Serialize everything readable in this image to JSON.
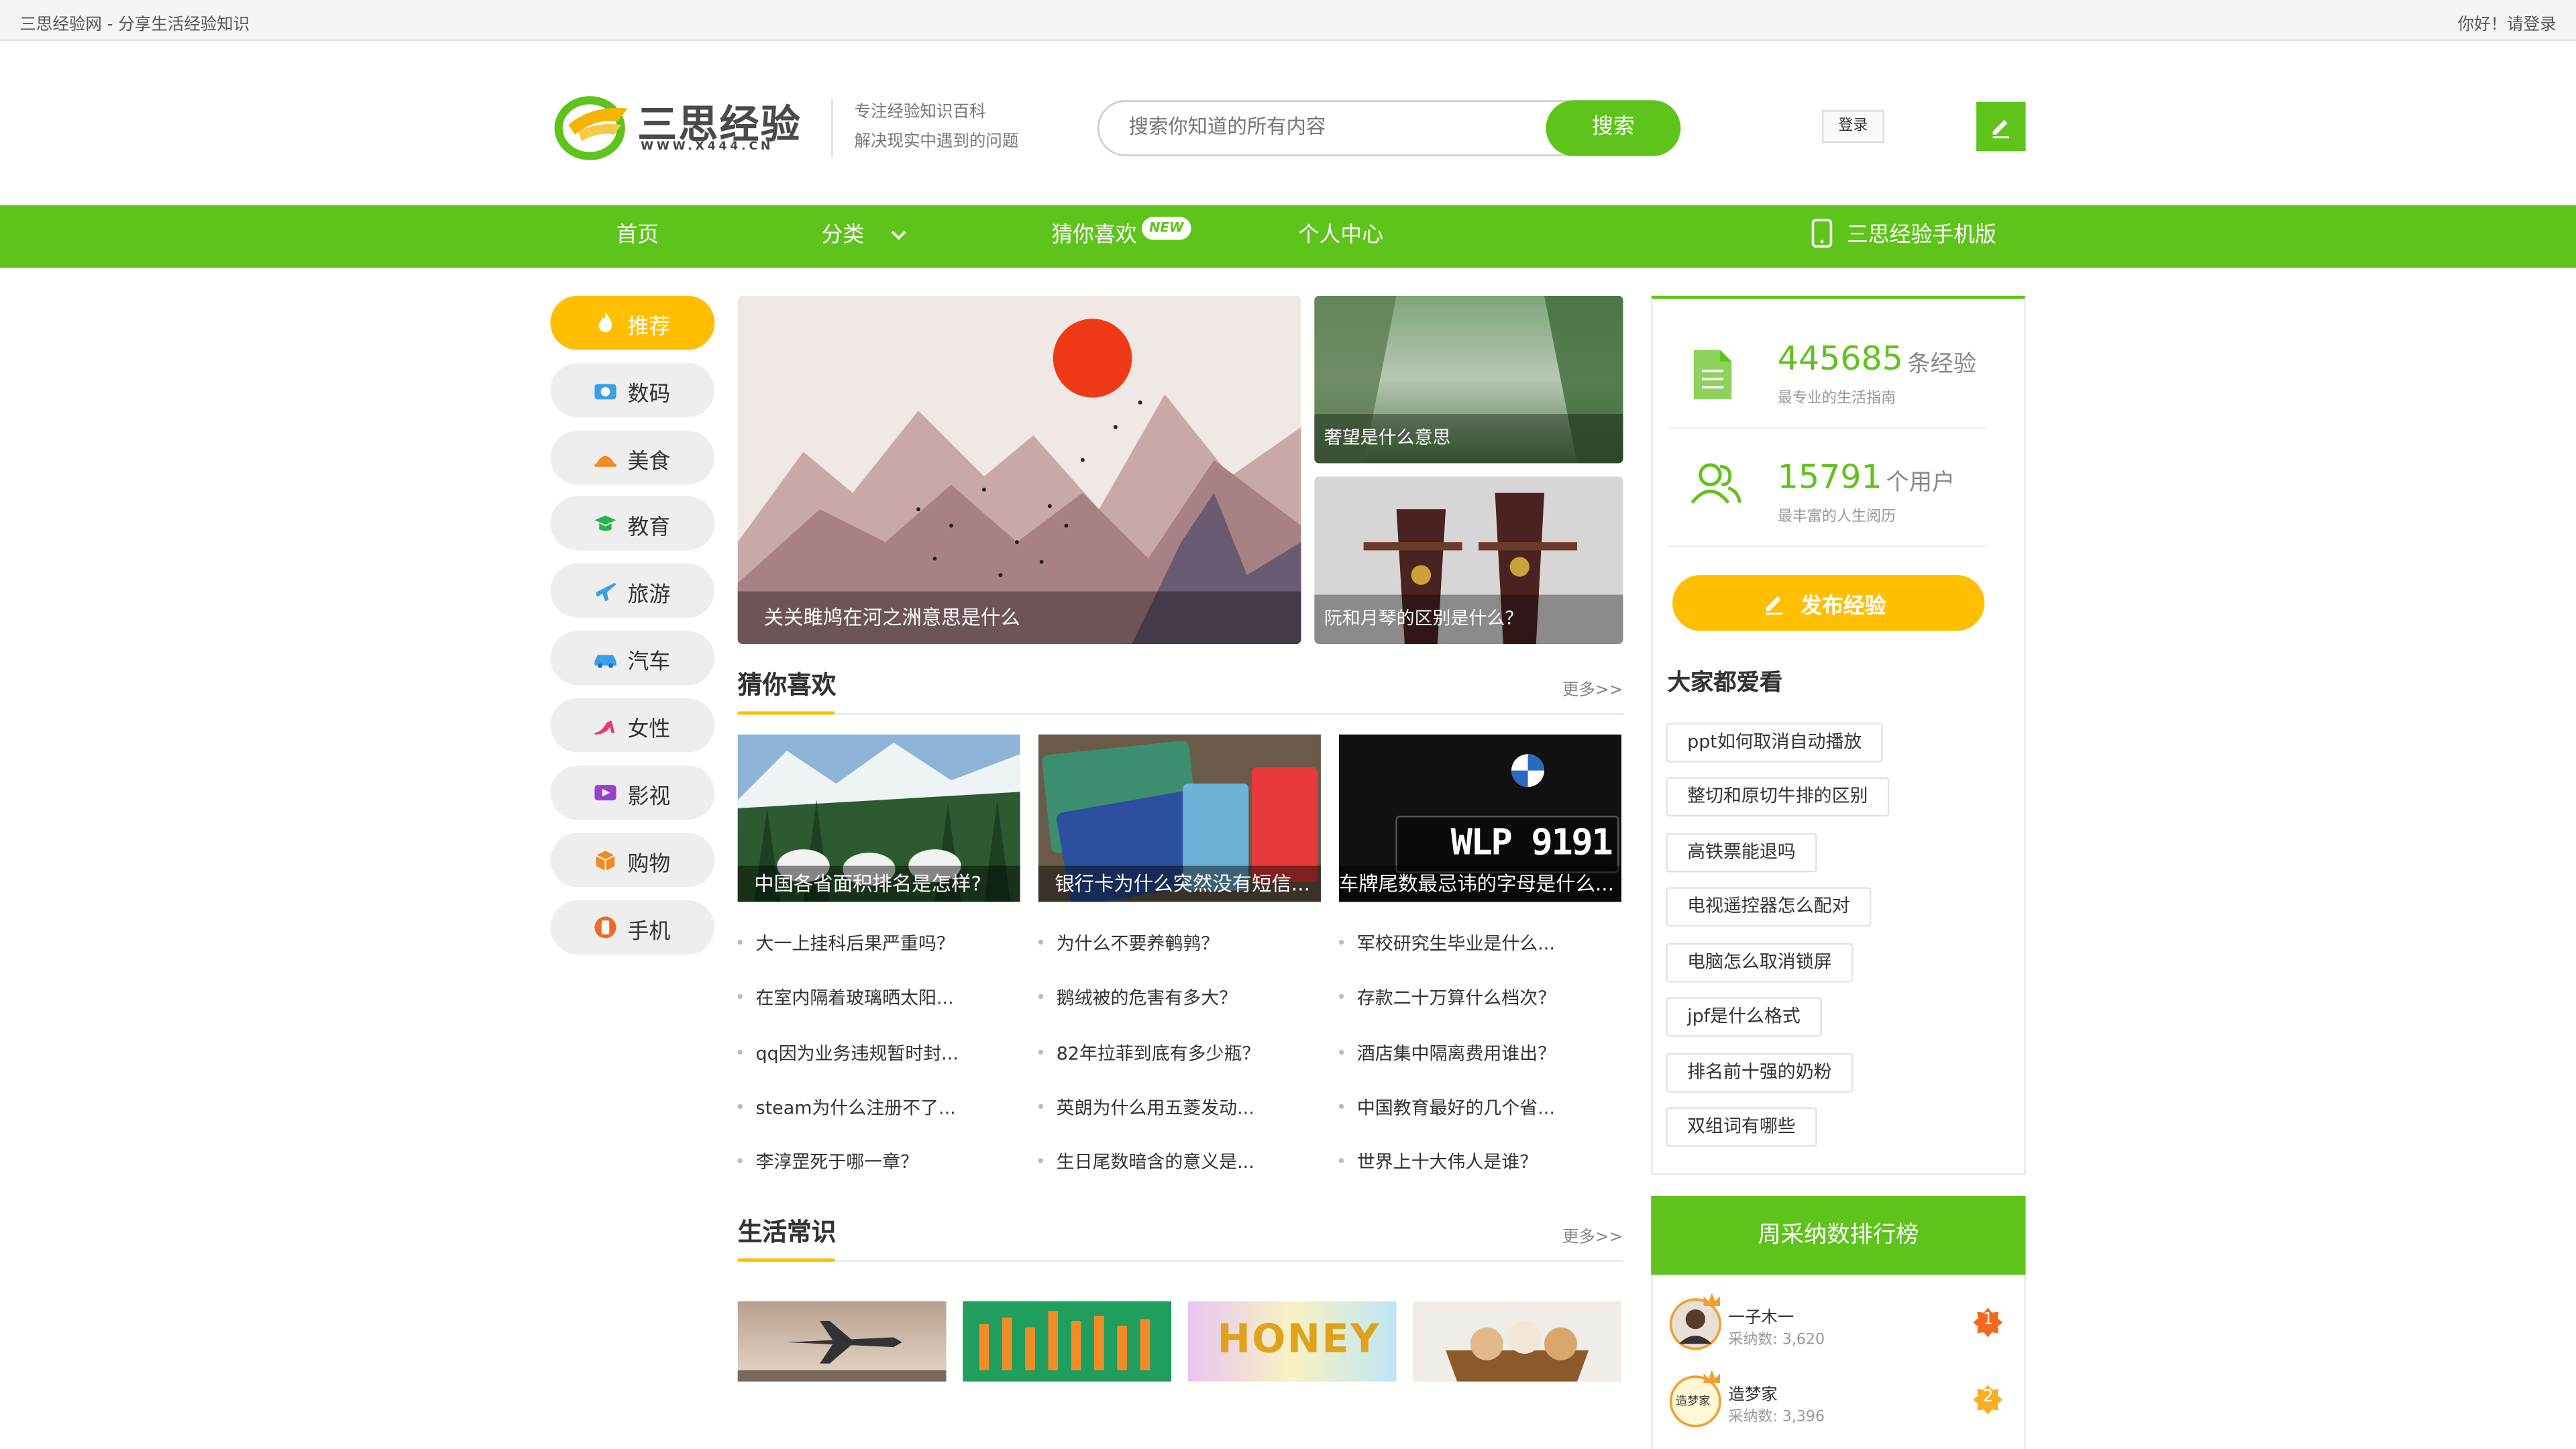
{
  "topbar": {
    "site_title": "三思经验网 - 分享生活经验知识",
    "greeting": "你好！请登录"
  },
  "header": {
    "logo_text": "三思经验",
    "logo_sub": "WWW.X444.CN",
    "slogan_line1": "专注经验知识百科",
    "slogan_line2": "解决现实中遇到的问题",
    "search_placeholder": "搜索你知道的所有内容",
    "search_button": "搜索",
    "login_button": "登录"
  },
  "nav": {
    "items": [
      "首页",
      "分类",
      "猜你喜欢",
      "个人中心"
    ],
    "new_badge": "NEW",
    "mobile_label": "三思经验手机版"
  },
  "categories": [
    {
      "label": "推荐",
      "icon": "flame-icon",
      "active": true
    },
    {
      "label": "数码",
      "icon": "camera-icon",
      "active": false
    },
    {
      "label": "美食",
      "icon": "dish-icon",
      "active": false
    },
    {
      "label": "教育",
      "icon": "graduation-cap-icon",
      "active": false
    },
    {
      "label": "旅游",
      "icon": "airplane-icon",
      "active": false
    },
    {
      "label": "汽车",
      "icon": "car-icon",
      "active": false
    },
    {
      "label": "女性",
      "icon": "high-heel-icon",
      "active": false
    },
    {
      "label": "影视",
      "icon": "video-icon",
      "active": false
    },
    {
      "label": "购物",
      "icon": "package-icon",
      "active": false
    },
    {
      "label": "手机",
      "icon": "phone-icon",
      "active": false
    }
  ],
  "banners": {
    "main": "关关雎鸠在河之洲意思是什么",
    "side_top": "奢望是什么意思",
    "side_bottom": "阮和月琴的区别是什么？"
  },
  "guess": {
    "title": "猜你喜欢",
    "more": "更多>>",
    "thumbs": [
      "中国各省面积排名是怎样?",
      "银行卡为什么突然没有短信...",
      "车牌尾数最忌讳的字母是什么..."
    ],
    "plate_text": "WLP 9191",
    "columns": [
      [
        "大一上挂科后果严重吗？",
        "在室内隔着玻璃晒太阳...",
        "qq因为业务违规暂时封...",
        "steam为什么注册不了...",
        "李淳罡死于哪一章？"
      ],
      [
        "为什么不要养鹌鹑？",
        "鹅绒被的危害有多大？",
        "82年拉菲到底有多少瓶？",
        "英朗为什么用五菱发动...",
        "生日尾数暗含的意义是..."
      ],
      [
        "军校研究生毕业是什么...",
        "存款二十万算什么档次？",
        "酒店集中隔离费用谁出？",
        "中国教育最好的几个省...",
        "世界上十大伟人是谁？"
      ]
    ]
  },
  "life": {
    "title": "生活常识",
    "more": "更多>>",
    "honey_text": "HONEY"
  },
  "stats": {
    "experiences_count": "445685",
    "experiences_unit": "条经验",
    "experiences_desc": "最专业的生活指南",
    "users_count": "15791",
    "users_unit": "个用户",
    "users_desc": "最丰富的人生阅历",
    "publish_button": "发布经验"
  },
  "popular": {
    "title": "大家都爱看",
    "tags": [
      "ppt如何取消自动播放",
      "整切和原切牛排的区别",
      "高铁票能退吗",
      "电视遥控器怎么配对",
      "电脑怎么取消锁屏",
      "jpf是什么格式",
      "排名前十强的奶粉",
      "双组词有哪些"
    ]
  },
  "ranking": {
    "title": "周采纳数排行榜",
    "users": [
      {
        "name": "一子木一",
        "count": "采纳数: 3,620",
        "rank": "1"
      },
      {
        "name": "造梦家",
        "count": "采纳数: 3,396",
        "rank": "2"
      }
    ],
    "avatar2_text": "造梦家"
  },
  "colors": {
    "brand_green": "#5ec31b",
    "accent_yellow": "#ffbf00"
  }
}
